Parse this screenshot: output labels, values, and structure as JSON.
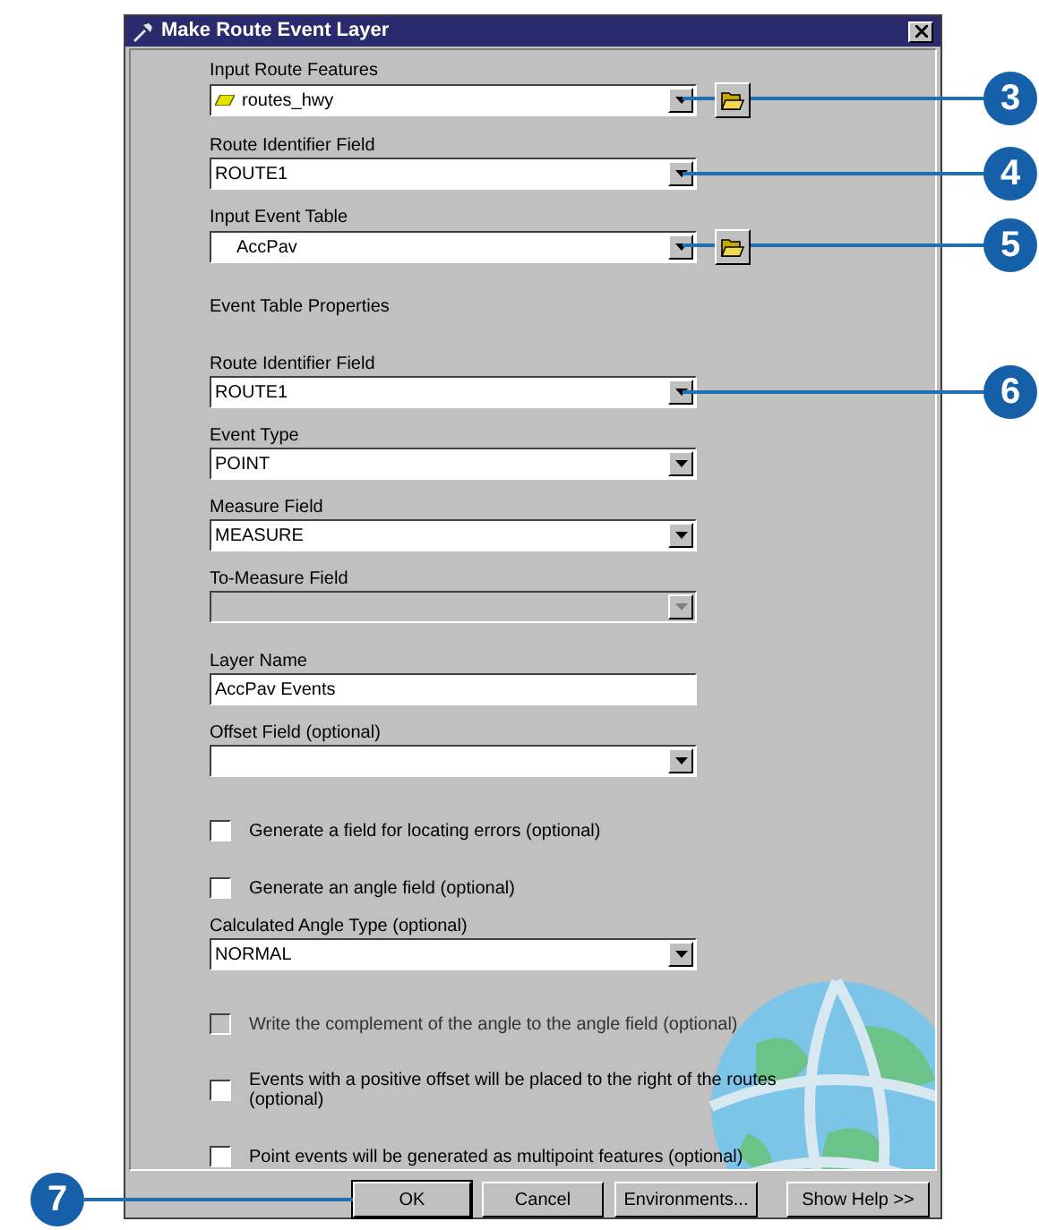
{
  "window": {
    "title": "Make Route Event Layer"
  },
  "fields": [
    {
      "kind": "combo",
      "label": "Input Route Features",
      "value": "routes_hwy",
      "layer_icon": true,
      "browse": true,
      "disabled": false,
      "callout": "3"
    },
    {
      "kind": "combo",
      "label": "Route Identifier Field",
      "value": "ROUTE1",
      "browse": false,
      "disabled": false,
      "callout": "4"
    },
    {
      "kind": "combo",
      "label": "Input Event Table",
      "value": "AccPav",
      "browse": true,
      "disabled": false,
      "callout": "5"
    },
    {
      "kind": "heading",
      "label": "Event Table Properties"
    },
    {
      "kind": "combo",
      "label": "Route Identifier Field",
      "value": "ROUTE1",
      "browse": false,
      "disabled": false,
      "callout": "6"
    },
    {
      "kind": "combo",
      "label": "Event Type",
      "value": "POINT",
      "browse": false,
      "disabled": false
    },
    {
      "kind": "combo",
      "label": "Measure Field",
      "value": "MEASURE",
      "browse": false,
      "disabled": false
    },
    {
      "kind": "combo",
      "label": "To-Measure Field",
      "browse": false,
      "disabled": true
    },
    {
      "kind": "text",
      "label": "Layer Name",
      "value": "AccPav Events"
    },
    {
      "kind": "combo",
      "label": "Offset Field (optional)",
      "browse": false,
      "disabled": false
    },
    {
      "kind": "checkbox",
      "label": "Generate a field for locating errors (optional)",
      "checked": false,
      "disabled": false
    },
    {
      "kind": "checkbox",
      "label": "Generate an angle field (optional)",
      "checked": false,
      "disabled": false
    },
    {
      "kind": "combo",
      "label": "Calculated Angle Type (optional)",
      "value": "NORMAL",
      "browse": false,
      "disabled": false
    },
    {
      "kind": "checkbox",
      "label": "Write the complement of the angle to the angle field (optional)",
      "checked": false,
      "disabled": true
    },
    {
      "kind": "checkbox",
      "label": "Events with a positive offset will be placed to the right of the routes (optional)",
      "checked": false,
      "disabled": false
    },
    {
      "kind": "checkbox",
      "label": "Point events will be generated as multipoint features (optional)",
      "checked": false,
      "disabled": false
    }
  ],
  "buttons": [
    {
      "label": "OK",
      "callout": "7"
    },
    {
      "label": "Cancel"
    },
    {
      "label": "Environments..."
    },
    {
      "label": "Show Help >>"
    }
  ]
}
